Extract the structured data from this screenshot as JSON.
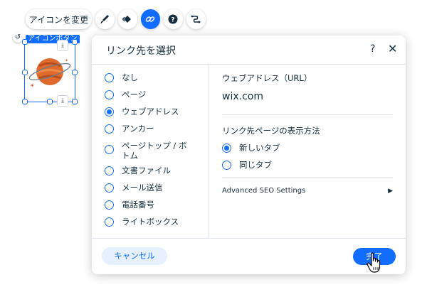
{
  "toolbar": {
    "change_icon_label": "アイコンを変更",
    "icons": [
      "brush-icon",
      "animation-icon",
      "link-icon",
      "help-icon",
      "connect-icon"
    ],
    "active_icon": "link-icon",
    "accent_color": "#116dff"
  },
  "canvas": {
    "element_label": "アイコンボタン",
    "undo_icon": "↺"
  },
  "dialog": {
    "title": "リンク先を選択",
    "help_label": "?",
    "close_label": "✕",
    "link_types": [
      {
        "label": "なし",
        "selected": false
      },
      {
        "label": "ページ",
        "selected": false
      },
      {
        "label": "ウェブアドレス",
        "selected": true
      },
      {
        "label": "アンカー",
        "selected": false
      },
      {
        "label": "ページトップ / ボトム",
        "selected": false
      },
      {
        "label": "文書ファイル",
        "selected": false
      },
      {
        "label": "メール送信",
        "selected": false
      },
      {
        "label": "電話番号",
        "selected": false
      },
      {
        "label": "ライトボックス",
        "selected": false
      }
    ],
    "web_address_label": "ウェブアドレス（URL）",
    "web_address_value": "wix.com",
    "display_method_label": "リンク先ページの表示方法",
    "display_options": [
      {
        "label": "新しいタブ",
        "selected": true
      },
      {
        "label": "同じタブ",
        "selected": false
      }
    ],
    "seo_settings_label": "Advanced SEO Settings",
    "cancel_label": "キャンセル",
    "done_label": "完了"
  }
}
